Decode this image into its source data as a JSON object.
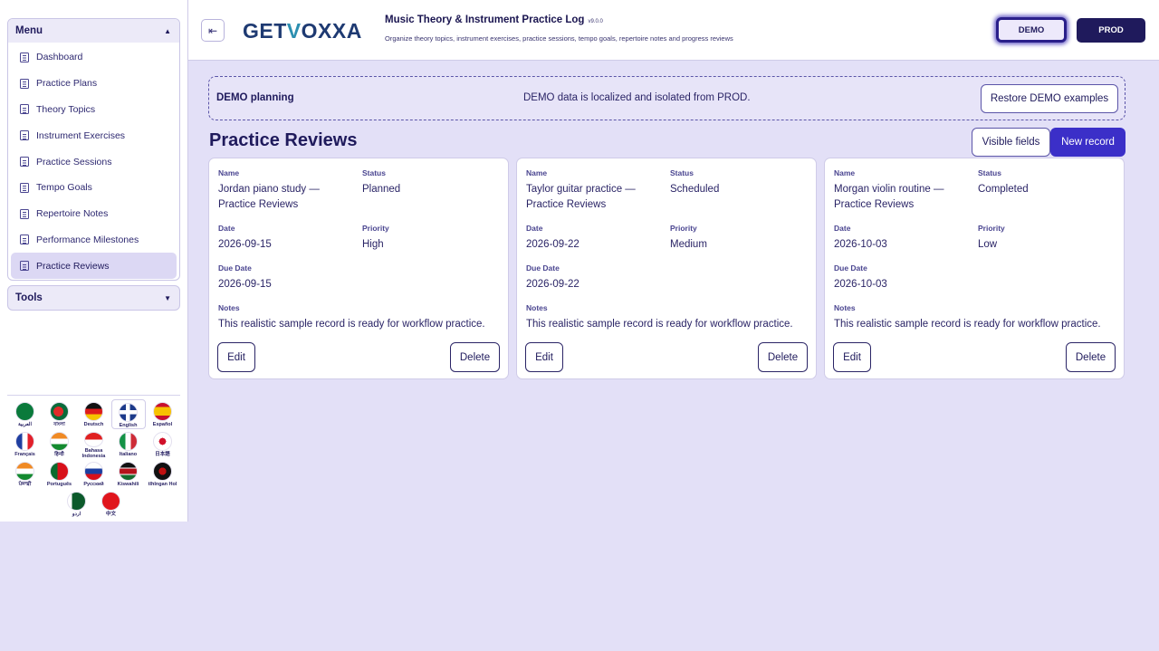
{
  "sidebar": {
    "menu_title": "Menu",
    "items": [
      {
        "label": "Dashboard"
      },
      {
        "label": "Practice Plans"
      },
      {
        "label": "Theory Topics"
      },
      {
        "label": "Instrument Exercises"
      },
      {
        "label": "Practice Sessions"
      },
      {
        "label": "Tempo Goals"
      },
      {
        "label": "Repertoire Notes"
      },
      {
        "label": "Performance Milestones"
      },
      {
        "label": "Practice Reviews",
        "active": true
      }
    ],
    "tools_title": "Tools"
  },
  "languages": [
    {
      "label": "العربية",
      "flag": "sa"
    },
    {
      "label": "বাংলা",
      "flag": "bd"
    },
    {
      "label": "Deutsch",
      "flag": "de"
    },
    {
      "label": "English",
      "flag": "gb",
      "selected": true
    },
    {
      "label": "Español",
      "flag": "es"
    },
    {
      "label": "Français",
      "flag": "fr"
    },
    {
      "label": "हिन्दी",
      "flag": "in"
    },
    {
      "label": "Bahasa Indonesia",
      "flag": "id"
    },
    {
      "label": "Italiano",
      "flag": "it"
    },
    {
      "label": "日本語",
      "flag": "jp"
    },
    {
      "label": "ਪੰਜਾਬੀ",
      "flag": "in"
    },
    {
      "label": "Português",
      "flag": "pt"
    },
    {
      "label": "Русский",
      "flag": "ru"
    },
    {
      "label": "Kiswahili",
      "flag": "ke"
    },
    {
      "label": "tlhIngan Hol",
      "flag": "kl"
    },
    {
      "label": "اردو",
      "flag": "pk"
    },
    {
      "label": "中文",
      "flag": "cn"
    }
  ],
  "header": {
    "logo_pre": "GET",
    "logo_v": "V",
    "logo_post": "OXXA",
    "title": "Music Theory & Instrument Practice Log",
    "version": "v9.0.0",
    "subtitle": "Organize theory topics, instrument exercises, practice sessions, tempo goals, repertoire notes and progress reviews",
    "env_demo": "DEMO",
    "env_prod": "PROD"
  },
  "banner": {
    "title": "DEMO planning",
    "message": "DEMO data is localized and isolated from PROD.",
    "restore_label": "Restore DEMO examples"
  },
  "main": {
    "page_title": "Practice Reviews",
    "visible_fields_label": "Visible fields",
    "new_record_label": "New record"
  },
  "labels": {
    "name": "Name",
    "status": "Status",
    "date": "Date",
    "priority": "Priority",
    "due_date": "Due Date",
    "notes": "Notes",
    "edit": "Edit",
    "delete": "Delete"
  },
  "records": [
    {
      "name": "Jordan piano study — Practice Reviews",
      "status": "Planned",
      "date": "2026-09-15",
      "priority": "High",
      "due_date": "2026-09-15",
      "notes": "This realistic sample record is ready for workflow practice."
    },
    {
      "name": "Taylor guitar practice — Practice Reviews",
      "status": "Scheduled",
      "date": "2026-09-22",
      "priority": "Medium",
      "due_date": "2026-09-22",
      "notes": "This realistic sample record is ready for workflow practice."
    },
    {
      "name": "Morgan violin routine — Practice Reviews",
      "status": "Completed",
      "date": "2026-10-03",
      "priority": "Low",
      "due_date": "2026-10-03",
      "notes": "This realistic sample record is ready for workflow practice."
    }
  ]
}
